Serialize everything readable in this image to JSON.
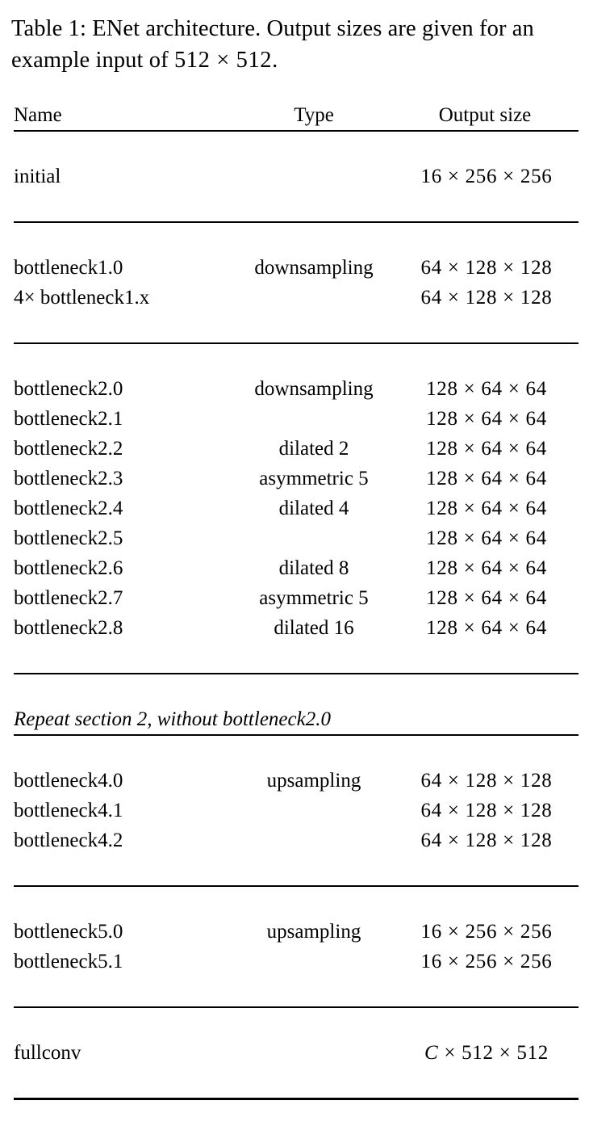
{
  "caption": {
    "prefix": "Table 1: ENet architecture. Output sizes are given for an example input of ",
    "input_size": "512 × 512",
    "suffix": "."
  },
  "table": {
    "columns": [
      "Name",
      "Type",
      "Output size"
    ],
    "sections": [
      {
        "id": "section-initial",
        "rows": [
          {
            "name": "initial",
            "type": "",
            "output": "16 × 256 × 256"
          }
        ]
      },
      {
        "id": "section-1",
        "rows": [
          {
            "name": "bottleneck1.0",
            "type": "downsampling",
            "output": "64 × 128 × 128"
          },
          {
            "name": "4× bottleneck1.x",
            "type": "",
            "output": "64 × 128 × 128"
          }
        ]
      },
      {
        "id": "section-2",
        "rows": [
          {
            "name": "bottleneck2.0",
            "type": "downsampling",
            "output": "128 × 64 × 64"
          },
          {
            "name": "bottleneck2.1",
            "type": "",
            "output": "128 × 64 × 64"
          },
          {
            "name": "bottleneck2.2",
            "type": "dilated 2",
            "output": "128 × 64 × 64"
          },
          {
            "name": "bottleneck2.3",
            "type": "asymmetric 5",
            "output": "128 × 64 × 64"
          },
          {
            "name": "bottleneck2.4",
            "type": "dilated 4",
            "output": "128 × 64 × 64"
          },
          {
            "name": "bottleneck2.5",
            "type": "",
            "output": "128 × 64 × 64"
          },
          {
            "name": "bottleneck2.6",
            "type": "dilated 8",
            "output": "128 × 64 × 64"
          },
          {
            "name": "bottleneck2.7",
            "type": "asymmetric 5",
            "output": "128 × 64 × 64"
          },
          {
            "name": "bottleneck2.8",
            "type": "dilated 16",
            "output": "128 × 64 × 64"
          }
        ]
      },
      {
        "id": "section-repeat",
        "note": "Repeat section 2, without bottleneck2.0",
        "rows": []
      },
      {
        "id": "section-4",
        "rows": [
          {
            "name": "bottleneck4.0",
            "type": "upsampling",
            "output": "64 × 128 × 128"
          },
          {
            "name": "bottleneck4.1",
            "type": "",
            "output": "64 × 128 × 128"
          },
          {
            "name": "bottleneck4.2",
            "type": "",
            "output": "64 × 128 × 128"
          }
        ]
      },
      {
        "id": "section-5",
        "rows": [
          {
            "name": "bottleneck5.0",
            "type": "upsampling",
            "output": "16 × 256 × 256"
          },
          {
            "name": "bottleneck5.1",
            "type": "",
            "output": "16 × 256 × 256"
          }
        ]
      },
      {
        "id": "section-fullconv",
        "rows": [
          {
            "name": "fullconv",
            "type": "",
            "output": "C × 512 × 512",
            "output_has_variable": true
          }
        ]
      }
    ]
  },
  "colors": {
    "text": "#000000",
    "background": "#ffffff",
    "rule": "#000000"
  }
}
